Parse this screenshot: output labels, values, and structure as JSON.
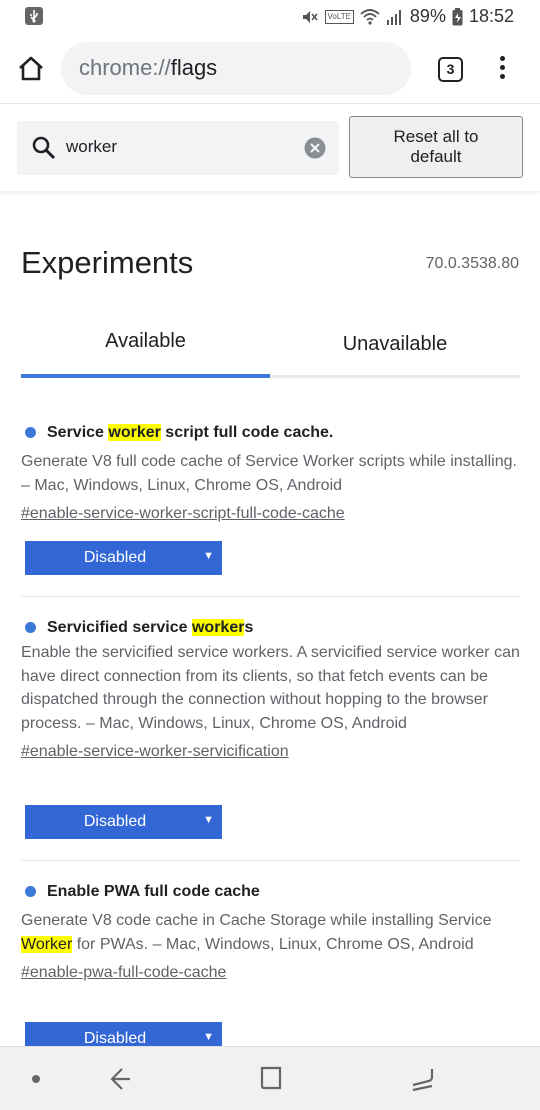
{
  "status_bar": {
    "battery": "89%",
    "time": "18:52",
    "volte": "VoLTE",
    "icons": [
      "usb-icon",
      "mute-icon",
      "volte-icon",
      "wifi-icon",
      "signal-icon",
      "battery-icon"
    ]
  },
  "omnibox": {
    "scheme": "chrome://",
    "host": "flags",
    "tab_count": "3",
    "icons": [
      "home-icon",
      "tabs-icon",
      "overflow-menu-icon"
    ]
  },
  "search": {
    "value": "worker",
    "reset_label_line1": "Reset all to",
    "reset_label_line2": "default",
    "icons": [
      "search-icon",
      "clear-icon"
    ]
  },
  "page": {
    "title": "Experiments",
    "version": "70.0.3538.80",
    "tabs": [
      {
        "label": "Available",
        "selected": true
      },
      {
        "label": "Unavailable",
        "selected": false
      }
    ]
  },
  "experiments": [
    {
      "title_before": "Service ",
      "title_highlight": "worker",
      "title_after": " script full code cache.",
      "description": "Generate V8 full code cache of Service Worker scripts while installing. – Mac, Windows, Linux, Chrome OS, Android",
      "link": "#enable-service-worker-script-full-code-cache",
      "state": "Disabled"
    },
    {
      "title_before": "Servicified service ",
      "title_highlight": "worker",
      "title_after": "s",
      "description": "Enable the servicified service workers. A servicified service worker can have direct connection from its clients, so that fetch events can be dispatched through the connection without hopping to the browser process. – Mac, Windows, Linux, Chrome OS, Android",
      "link": "#enable-service-worker-servicification",
      "state": "Disabled"
    },
    {
      "title": "Enable PWA full code cache",
      "desc_before": "Generate V8 code cache in Cache Storage while installing Service ",
      "desc_highlight": "Worker",
      "desc_after": " for PWAs. – Mac, Windows, Linux, Chrome OS, Android",
      "link": "#enable-pwa-full-code-cache",
      "state": "Disabled"
    }
  ],
  "colors": {
    "accent": "#3c78d8",
    "select_bg": "#3367d6",
    "highlight": "#ffff00"
  },
  "navbar": {
    "icons": [
      "nav-dot-icon",
      "back-icon",
      "home-square-icon",
      "recent-apps-icon"
    ]
  }
}
